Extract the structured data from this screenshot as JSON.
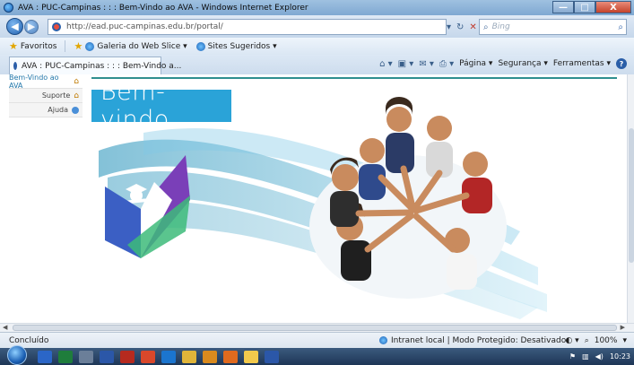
{
  "window": {
    "title": "AVA : PUC-Campinas : : : Bem-Vindo ao AVA - Windows Internet Explorer",
    "controls": [
      "—",
      "□",
      "X"
    ]
  },
  "addressbar": {
    "url": "http://ead.puc-campinas.edu.br/portal/",
    "search_placeholder": "Bing"
  },
  "favorites": {
    "label": "Favoritos",
    "items": [
      "Galeria do Web Slice ▾",
      "Sites Sugeridos ▾"
    ]
  },
  "tab": {
    "label": "AVA : PUC-Campinas : : : Bem-Vindo a..."
  },
  "commandbar": {
    "items": [
      "Página ▾",
      "Segurança ▾",
      "Ferramentas ▾"
    ]
  },
  "sidemenu": {
    "items": [
      {
        "label": "Bem-Vindo ao AVA",
        "icon": "home-icon"
      },
      {
        "label": "Suporte",
        "icon": "home-icon"
      },
      {
        "label": "Ajuda",
        "icon": "help-icon"
      }
    ]
  },
  "banner": {
    "text": "Bem-vindo"
  },
  "statusbar": {
    "status": "Concluído",
    "zone": "Intranet local | Modo Protegido: Desativado",
    "zoom": "100%"
  },
  "taskbar": {
    "clock": "10:23"
  },
  "colors": {
    "banner": "#2aa3d8",
    "teal_line": "#2f8f8f",
    "logo_blue": "#3b5fc4",
    "logo_purple": "#7a3fb8",
    "logo_green": "#3dbb7a"
  }
}
